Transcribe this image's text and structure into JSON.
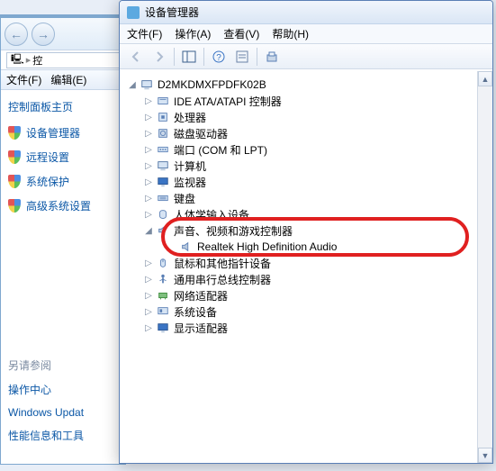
{
  "back_window": {
    "nav": {
      "back": "←",
      "fwd": "→"
    },
    "addressbar": {
      "icon_glyph": "🖥",
      "text": "控"
    },
    "menu": {
      "file": "文件(F)",
      "edit": "编辑(E)"
    },
    "sidebar": {
      "home_label": "控制面板主页",
      "links": [
        {
          "label": "设备管理器"
        },
        {
          "label": "远程设置"
        },
        {
          "label": "系统保护"
        },
        {
          "label": "高级系统设置"
        }
      ],
      "seealso_title": "另请参阅",
      "seealso_links": [
        {
          "label": "操作中心"
        },
        {
          "label": "Windows Updat"
        },
        {
          "label": "性能信息和工具"
        }
      ]
    }
  },
  "device_manager": {
    "title": "设备管理器",
    "menu": {
      "file": "文件(F)",
      "action": "操作(A)",
      "view": "查看(V)",
      "help": "帮助(H)"
    },
    "root_label": "D2MKDMXFPDFK02B",
    "nodes": [
      {
        "label": "IDE ATA/ATAPI 控制器",
        "icon": "ide"
      },
      {
        "label": "处理器",
        "icon": "cpu"
      },
      {
        "label": "磁盘驱动器",
        "icon": "disk"
      },
      {
        "label": "端口 (COM 和 LPT)",
        "icon": "port"
      },
      {
        "label": "计算机",
        "icon": "computer"
      },
      {
        "label": "监视器",
        "icon": "monitor"
      },
      {
        "label": "键盘",
        "icon": "keyboard"
      },
      {
        "label": "人体学输入设备",
        "icon": "hid"
      }
    ],
    "sound_node": {
      "label": "声音、视频和游戏控制器",
      "expanded": true,
      "child": {
        "label": "Realtek High Definition Audio"
      }
    },
    "nodes_after": [
      {
        "label": "鼠标和其他指针设备",
        "icon": "mouse"
      },
      {
        "label": "通用串行总线控制器",
        "icon": "usb"
      },
      {
        "label": "网络适配器",
        "icon": "net"
      },
      {
        "label": "系统设备",
        "icon": "system"
      },
      {
        "label": "显示适配器",
        "icon": "display"
      }
    ]
  }
}
